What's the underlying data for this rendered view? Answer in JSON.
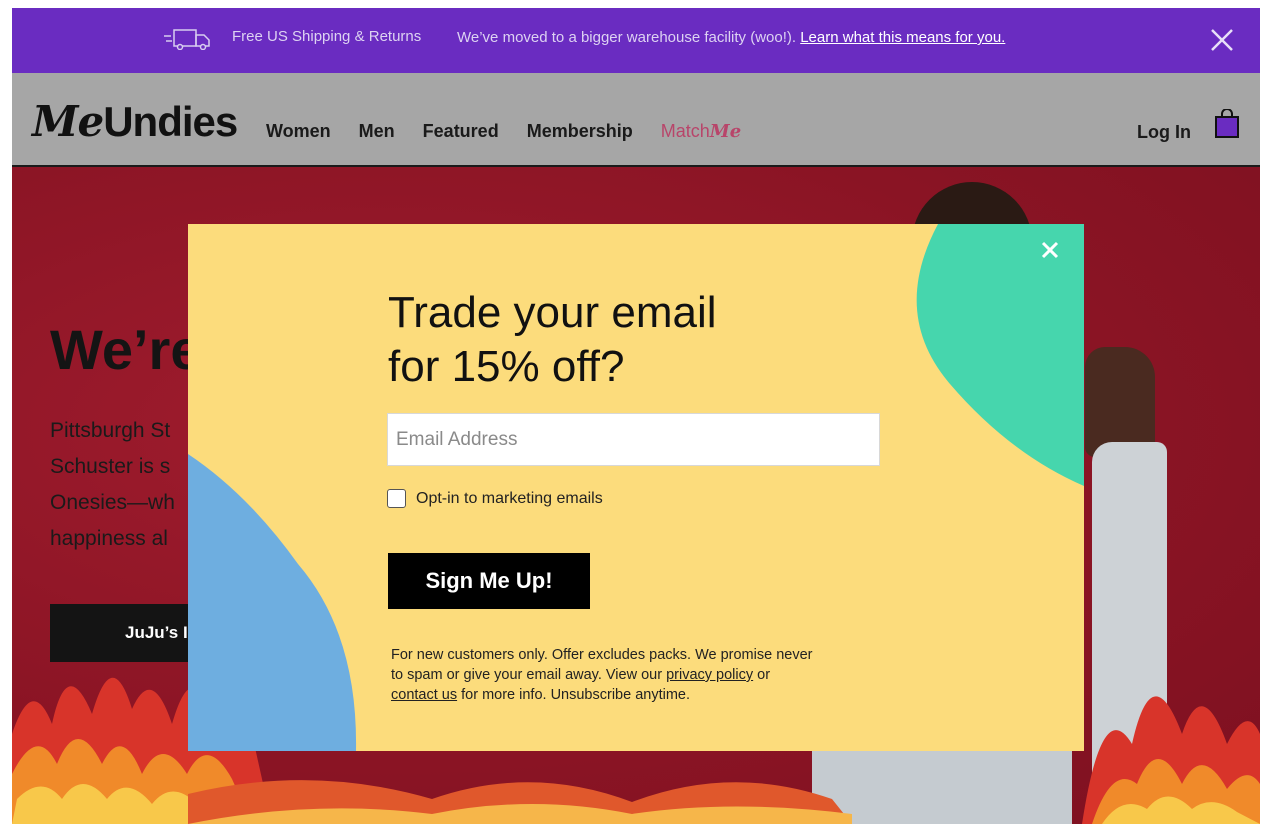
{
  "announcement": {
    "shipping": "Free US Shipping & Returns",
    "moved": "We’ve moved to a bigger warehouse facility (woo!).",
    "link": "Learn what this means for you."
  },
  "header": {
    "logo_script": "Me",
    "logo_text": "Undies",
    "nav": [
      "Women",
      "Men",
      "Featured",
      "Membership"
    ],
    "matchme_a": "Match",
    "matchme_b": "Me",
    "login": "Log In"
  },
  "hero": {
    "heading": "We’re",
    "copy_lines": [
      "Pittsburgh St",
      "Schuster is s",
      "Onesies—wh",
      "happiness al"
    ],
    "cta": "JuJu’s I"
  },
  "modal": {
    "title_line1": "Trade your email",
    "title_line2": "for 15% off?",
    "email_placeholder": "Email Address",
    "optin_label": "Opt-in to marketing emails",
    "signup_label": "Sign Me Up!",
    "fine_1": "For new customers only. Offer excludes packs. We promise never",
    "fine_2": "to spam or give your email away. View our",
    "privacy": "privacy policy",
    "fine_or": "or",
    "contact": "contact us",
    "fine_3": "for more info. Unsubscribe anytime."
  },
  "colors": {
    "announcement_bg": "#6a2cc1",
    "modal_bg": "#fcdc7c",
    "blob_teal": "#46d6ad",
    "blob_blue": "#6eaee0",
    "hero_red": "#8e1525",
    "bag_purple": "#6a2cc1"
  },
  "icons": [
    "truck-icon",
    "close-icon",
    "bag-icon",
    "modal-close-icon"
  ]
}
